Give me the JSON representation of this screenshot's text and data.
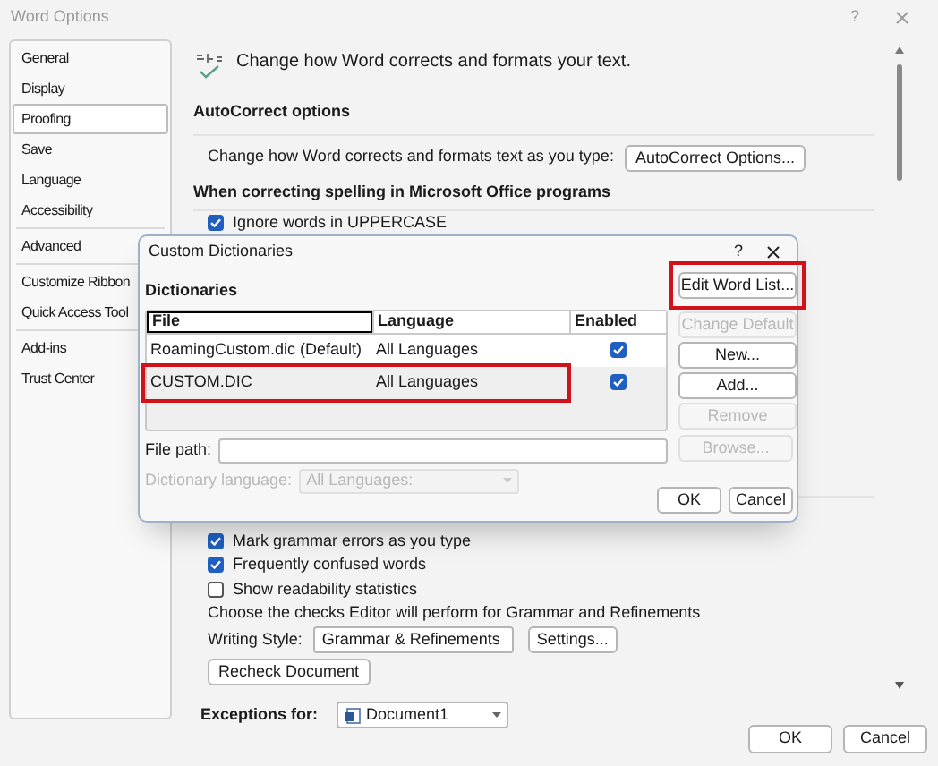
{
  "window": {
    "title": "Word Options",
    "help": "?"
  },
  "sidebar": {
    "groups": [
      [
        {
          "label": "General",
          "selected": false
        },
        {
          "label": "Display",
          "selected": false
        },
        {
          "label": "Proofing",
          "selected": true
        },
        {
          "label": "Save",
          "selected": false
        },
        {
          "label": "Language",
          "selected": false
        },
        {
          "label": "Accessibility",
          "selected": false
        }
      ],
      [
        {
          "label": "Advanced",
          "selected": false
        }
      ],
      [
        {
          "label": "Customize Ribbon",
          "selected": false
        },
        {
          "label": "Quick Access Tool",
          "selected": false
        }
      ],
      [
        {
          "label": "Add-ins",
          "selected": false
        },
        {
          "label": "Trust Center",
          "selected": false
        }
      ]
    ]
  },
  "header": {
    "text": "Change how Word corrects and formats your text."
  },
  "autocorrect": {
    "heading": "AutoCorrect options",
    "text": "Change how Word corrects and formats text as you type:",
    "button": "AutoCorrect Options..."
  },
  "spelling": {
    "heading": "When correcting spelling in Microsoft Office programs",
    "options": [
      {
        "label": "Ignore words in UPPERCASE",
        "checked": true
      }
    ]
  },
  "grammar": {
    "options": [
      {
        "label": "Mark grammar errors as you type",
        "checked": true
      },
      {
        "label": "Frequently confused words",
        "checked": true
      },
      {
        "label": "Show readability statistics",
        "checked": false
      }
    ],
    "note": "Choose the checks Editor will perform for Grammar and Refinements",
    "writing_style": {
      "label": "Writing Style:",
      "value": "Grammar & Refinements"
    },
    "settings_button": "Settings...",
    "recheck_button": "Recheck Document"
  },
  "exceptions": {
    "label": "Exceptions for:",
    "value": "Document1"
  },
  "buttons": [
    {
      "label": "OK"
    },
    {
      "label": "Cancel"
    }
  ],
  "dialog": {
    "title": "Custom Dictionaries",
    "help": "?",
    "section": "Dictionaries",
    "table": {
      "columns": [
        {
          "label": "File",
          "focused": true
        },
        {
          "label": "Language",
          "focused": false
        },
        {
          "label": "Enabled",
          "focused": false
        }
      ],
      "rows": [
        {
          "file": "RoamingCustom.dic (Default)",
          "language": "All Languages",
          "enabled": true,
          "highlighted": false
        },
        {
          "file": "CUSTOM.DIC",
          "language": "All Languages",
          "enabled": true,
          "highlighted": true
        }
      ]
    },
    "side_buttons": [
      {
        "label": "Edit Word List...",
        "disabled": false,
        "highlighted": true
      },
      {
        "label": "Change Default",
        "disabled": true,
        "highlighted": false
      },
      {
        "label": "New...",
        "disabled": false,
        "highlighted": false
      },
      {
        "label": "Add...",
        "disabled": false,
        "highlighted": false
      },
      {
        "label": "Remove",
        "disabled": true,
        "highlighted": false
      }
    ],
    "file_path": {
      "label": "File path:"
    },
    "browse_button": {
      "label": "Browse...",
      "disabled": true
    },
    "dictionary_language": {
      "label": "Dictionary language:",
      "value": "All Languages:",
      "disabled": true
    },
    "footer_buttons": [
      {
        "label": "OK"
      },
      {
        "label": "Cancel"
      }
    ]
  }
}
